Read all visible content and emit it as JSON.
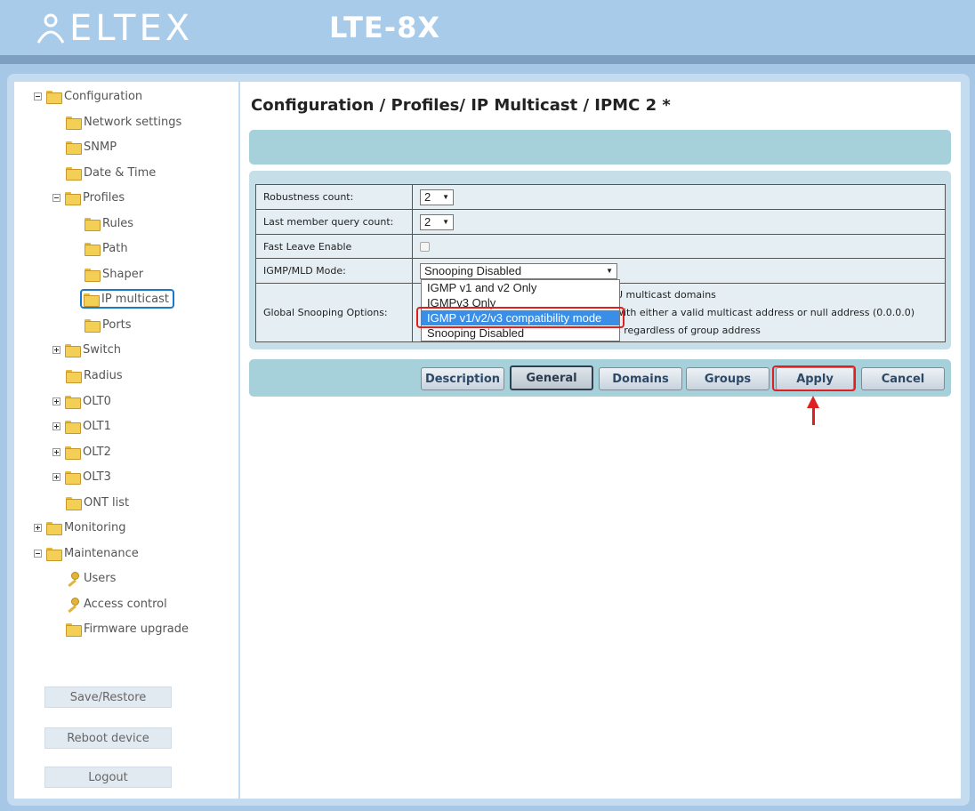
{
  "header": {
    "brand": "ELTEX",
    "model": "LTE-8X"
  },
  "sidebar": {
    "tree": [
      {
        "label": "Configuration",
        "icon": "folder-icon",
        "expander": "minus"
      },
      {
        "label": "Network settings",
        "icon": "folder-icon"
      },
      {
        "label": "SNMP",
        "icon": "folder-icon"
      },
      {
        "label": "Date & Time",
        "icon": "folder-icon"
      },
      {
        "label": "Profiles",
        "icon": "folder-icon",
        "expander": "minus"
      },
      {
        "label": "Rules",
        "icon": "folder-icon"
      },
      {
        "label": "Path",
        "icon": "folder-icon"
      },
      {
        "label": "Shaper",
        "icon": "folder-icon"
      },
      {
        "label": "IP multicast",
        "icon": "folder-icon",
        "selected": true
      },
      {
        "label": "Ports",
        "icon": "folder-icon"
      },
      {
        "label": "Switch",
        "icon": "folder-icon",
        "expander": "plus"
      },
      {
        "label": "Radius",
        "icon": "folder-icon"
      },
      {
        "label": "OLT0",
        "icon": "folder-icon",
        "expander": "plus"
      },
      {
        "label": "OLT1",
        "icon": "folder-icon",
        "expander": "plus"
      },
      {
        "label": "OLT2",
        "icon": "folder-icon",
        "expander": "plus"
      },
      {
        "label": "OLT3",
        "icon": "folder-icon",
        "expander": "plus"
      },
      {
        "label": "ONT list",
        "icon": "folder-icon"
      },
      {
        "label": "Monitoring",
        "icon": "folder-icon",
        "expander": "plus"
      },
      {
        "label": "Maintenance",
        "icon": "folder-icon",
        "expander": "minus"
      },
      {
        "label": "Users",
        "icon": "key-icon"
      },
      {
        "label": "Access control",
        "icon": "key-icon"
      },
      {
        "label": "Firmware upgrade",
        "icon": "folder-icon"
      }
    ],
    "buttons": {
      "save_restore": "Save/Restore",
      "reboot": "Reboot device",
      "logout": "Logout"
    }
  },
  "main": {
    "title": "Configuration / Profiles/ IP Multicast / IPMC 2 *",
    "form": {
      "robustness_label": "Robustness count:",
      "robustness_value": "2",
      "last_member_label": "Last member query count:",
      "last_member_value": "2",
      "fast_leave_label": "Fast Leave Enable",
      "fast_leave_checked": false,
      "mode_label": "IGMP/MLD Mode:",
      "mode_value": "Snooping Disabled",
      "global_label": "Global Snooping Options:",
      "global_options": [
        "U multicast domains",
        "with either a valid multicast address or null address (0.0.0.0)",
        "s regardless of group address"
      ]
    },
    "mode_dropdown": {
      "options": [
        "IGMP v1 and v2 Only",
        "IGMPv3 Only",
        "IGMP v1/v2/v3 compatibility mode",
        "Snooping Disabled"
      ],
      "highlighted_index": 2
    },
    "buttons": {
      "description": "Description",
      "general": "General",
      "domains": "Domains",
      "groups": "Groups",
      "apply": "Apply",
      "cancel": "Cancel"
    }
  },
  "colors": {
    "header_bg": "#a9cbea",
    "annotation_red": "#e02020",
    "selection_blue": "#3a8ee6"
  }
}
